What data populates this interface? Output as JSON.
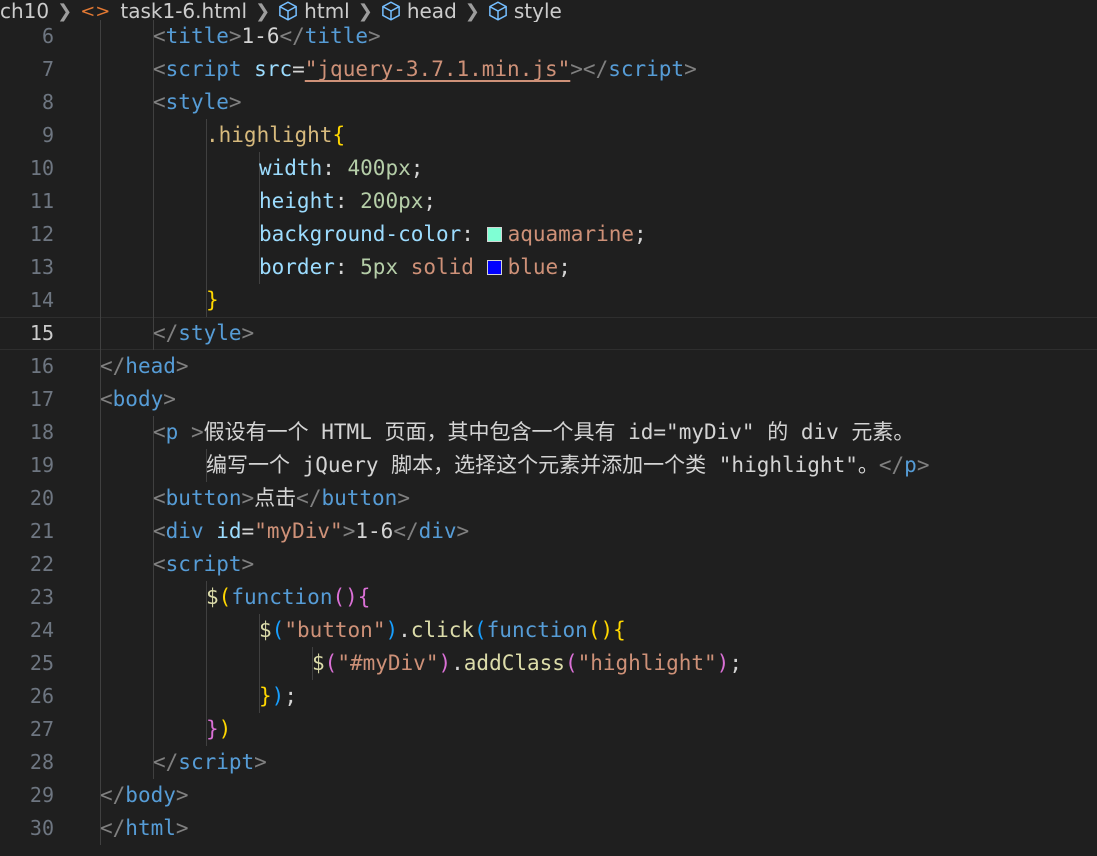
{
  "breadcrumb": {
    "folder": "ch10",
    "file": "task1-6.html",
    "html": "html",
    "head": "head",
    "style": "style"
  },
  "colors": {
    "aquamarine": "#7fffd4",
    "blue": "#0000ff"
  },
  "lines": [
    {
      "num": "6",
      "indent": 2,
      "tokens": [
        [
          "t-punc",
          "<"
        ],
        [
          "t-tag",
          "title"
        ],
        [
          "t-punc",
          ">"
        ],
        [
          "t-text",
          "1-6"
        ],
        [
          "t-punc",
          "</"
        ],
        [
          "t-tag",
          "title"
        ],
        [
          "t-punc",
          ">"
        ]
      ]
    },
    {
      "num": "7",
      "indent": 2,
      "tokens": [
        [
          "t-punc",
          "<"
        ],
        [
          "t-tag",
          "script"
        ],
        [
          "t-text",
          " "
        ],
        [
          "t-attr",
          "src"
        ],
        [
          "t-text",
          "="
        ],
        [
          "t-str t-link",
          "\"jquery-3.7.1.min.js\""
        ],
        [
          "t-punc",
          "></"
        ],
        [
          "t-tag",
          "script"
        ],
        [
          "t-punc",
          ">"
        ]
      ]
    },
    {
      "num": "8",
      "indent": 2,
      "tokens": [
        [
          "t-punc",
          "<"
        ],
        [
          "t-tag",
          "style"
        ],
        [
          "t-punc",
          ">"
        ]
      ]
    },
    {
      "num": "9",
      "indent": 3,
      "tokens": [
        [
          "t-sel",
          ".highlight"
        ],
        [
          "t-b1",
          "{"
        ]
      ]
    },
    {
      "num": "10",
      "indent": 4,
      "tokens": [
        [
          "t-prop",
          "width"
        ],
        [
          "t-text",
          ": "
        ],
        [
          "t-num",
          "400px"
        ],
        [
          "t-text",
          ";"
        ]
      ]
    },
    {
      "num": "11",
      "indent": 4,
      "tokens": [
        [
          "t-prop",
          "height"
        ],
        [
          "t-text",
          ": "
        ],
        [
          "t-num",
          "200px"
        ],
        [
          "t-text",
          ";"
        ]
      ]
    },
    {
      "num": "12",
      "indent": 4,
      "tokens": [
        [
          "t-prop",
          "background-color"
        ],
        [
          "t-text",
          ": "
        ],
        [
          "swatch",
          "aquamarine"
        ],
        [
          "t-val",
          "aquamarine"
        ],
        [
          "t-text",
          ";"
        ]
      ]
    },
    {
      "num": "13",
      "indent": 4,
      "tokens": [
        [
          "t-prop",
          "border"
        ],
        [
          "t-text",
          ": "
        ],
        [
          "t-num",
          "5px"
        ],
        [
          "t-val",
          " solid "
        ],
        [
          "swatch",
          "blue"
        ],
        [
          "t-val",
          "blue"
        ],
        [
          "t-text",
          ";"
        ]
      ]
    },
    {
      "num": "14",
      "indent": 3,
      "tokens": [
        [
          "t-b1",
          "}"
        ]
      ]
    },
    {
      "num": "15",
      "indent": 2,
      "current": true,
      "tokens": [
        [
          "t-punc",
          "</"
        ],
        [
          "t-tag",
          "style"
        ],
        [
          "t-punc",
          ">"
        ]
      ]
    },
    {
      "num": "16",
      "indent": 1,
      "tokens": [
        [
          "t-punc",
          "</"
        ],
        [
          "t-tag",
          "head"
        ],
        [
          "t-punc",
          ">"
        ]
      ]
    },
    {
      "num": "17",
      "indent": 1,
      "tokens": [
        [
          "t-punc",
          "<"
        ],
        [
          "t-tag",
          "body"
        ],
        [
          "t-punc",
          ">"
        ]
      ]
    },
    {
      "num": "18",
      "indent": 2,
      "tokens": [
        [
          "t-punc",
          "<"
        ],
        [
          "t-tag",
          "p"
        ],
        [
          "t-text",
          " "
        ],
        [
          "t-punc",
          ">"
        ],
        [
          "t-text",
          "假设有一个 HTML 页面，其中包含一个具有 id=\"myDiv\" 的 div 元素。"
        ]
      ]
    },
    {
      "num": "19",
      "indent": 3,
      "tokens": [
        [
          "t-text",
          "编写一个 jQuery 脚本，选择这个元素并添加一个类 \"highlight\"。"
        ],
        [
          "t-punc",
          "</"
        ],
        [
          "t-tag",
          "p"
        ],
        [
          "t-punc",
          ">"
        ]
      ]
    },
    {
      "num": "20",
      "indent": 2,
      "tokens": [
        [
          "t-punc",
          "<"
        ],
        [
          "t-tag",
          "button"
        ],
        [
          "t-punc",
          ">"
        ],
        [
          "t-text",
          "点击"
        ],
        [
          "t-punc",
          "</"
        ],
        [
          "t-tag",
          "button"
        ],
        [
          "t-punc",
          ">"
        ]
      ]
    },
    {
      "num": "21",
      "indent": 2,
      "tokens": [
        [
          "t-punc",
          "<"
        ],
        [
          "t-tag",
          "div"
        ],
        [
          "t-text",
          " "
        ],
        [
          "t-attr",
          "id"
        ],
        [
          "t-text",
          "="
        ],
        [
          "t-str",
          "\"myDiv\""
        ],
        [
          "t-punc",
          ">"
        ],
        [
          "t-text",
          "1-6"
        ],
        [
          "t-punc",
          "</"
        ],
        [
          "t-tag",
          "div"
        ],
        [
          "t-punc",
          ">"
        ]
      ]
    },
    {
      "num": "22",
      "indent": 2,
      "tokens": [
        [
          "t-punc",
          "<"
        ],
        [
          "t-tag",
          "script"
        ],
        [
          "t-punc",
          ">"
        ]
      ]
    },
    {
      "num": "23",
      "indent": 3,
      "tokens": [
        [
          "t-var",
          "$"
        ],
        [
          "t-b1",
          "("
        ],
        [
          "t-kw",
          "function"
        ],
        [
          "t-b2",
          "()"
        ],
        [
          "t-b2",
          "{"
        ]
      ]
    },
    {
      "num": "24",
      "indent": 4,
      "tokens": [
        [
          "t-var",
          "$"
        ],
        [
          "t-b3",
          "("
        ],
        [
          "t-str",
          "\"button\""
        ],
        [
          "t-b3",
          ")"
        ],
        [
          "t-text",
          "."
        ],
        [
          "t-fn",
          "click"
        ],
        [
          "t-b3",
          "("
        ],
        [
          "t-kw",
          "function"
        ],
        [
          "t-b1",
          "()"
        ],
        [
          "t-b1",
          "{"
        ]
      ]
    },
    {
      "num": "25",
      "indent": 5,
      "tokens": [
        [
          "t-var",
          "$"
        ],
        [
          "t-b2",
          "("
        ],
        [
          "t-str",
          "\"#myDiv\""
        ],
        [
          "t-b2",
          ")"
        ],
        [
          "t-text",
          "."
        ],
        [
          "t-fn",
          "addClass"
        ],
        [
          "t-b2",
          "("
        ],
        [
          "t-str",
          "\"highlight\""
        ],
        [
          "t-b2",
          ")"
        ],
        [
          "t-text",
          ";"
        ]
      ]
    },
    {
      "num": "26",
      "indent": 4,
      "tokens": [
        [
          "t-b1",
          "}"
        ],
        [
          "t-b3",
          ")"
        ],
        [
          "t-text",
          ";"
        ]
      ]
    },
    {
      "num": "27",
      "indent": 3,
      "tokens": [
        [
          "t-b2",
          "}"
        ],
        [
          "t-b1",
          ")"
        ]
      ]
    },
    {
      "num": "28",
      "indent": 2,
      "tokens": [
        [
          "t-punc",
          "</"
        ],
        [
          "t-tag",
          "script"
        ],
        [
          "t-punc",
          ">"
        ]
      ]
    },
    {
      "num": "29",
      "indent": 1,
      "tokens": [
        [
          "t-punc",
          "</"
        ],
        [
          "t-tag",
          "body"
        ],
        [
          "t-punc",
          ">"
        ]
      ]
    },
    {
      "num": "30",
      "indent": 1,
      "tokens": [
        [
          "t-punc",
          "</"
        ],
        [
          "t-tag",
          "html"
        ],
        [
          "t-punc",
          ">"
        ]
      ]
    }
  ]
}
